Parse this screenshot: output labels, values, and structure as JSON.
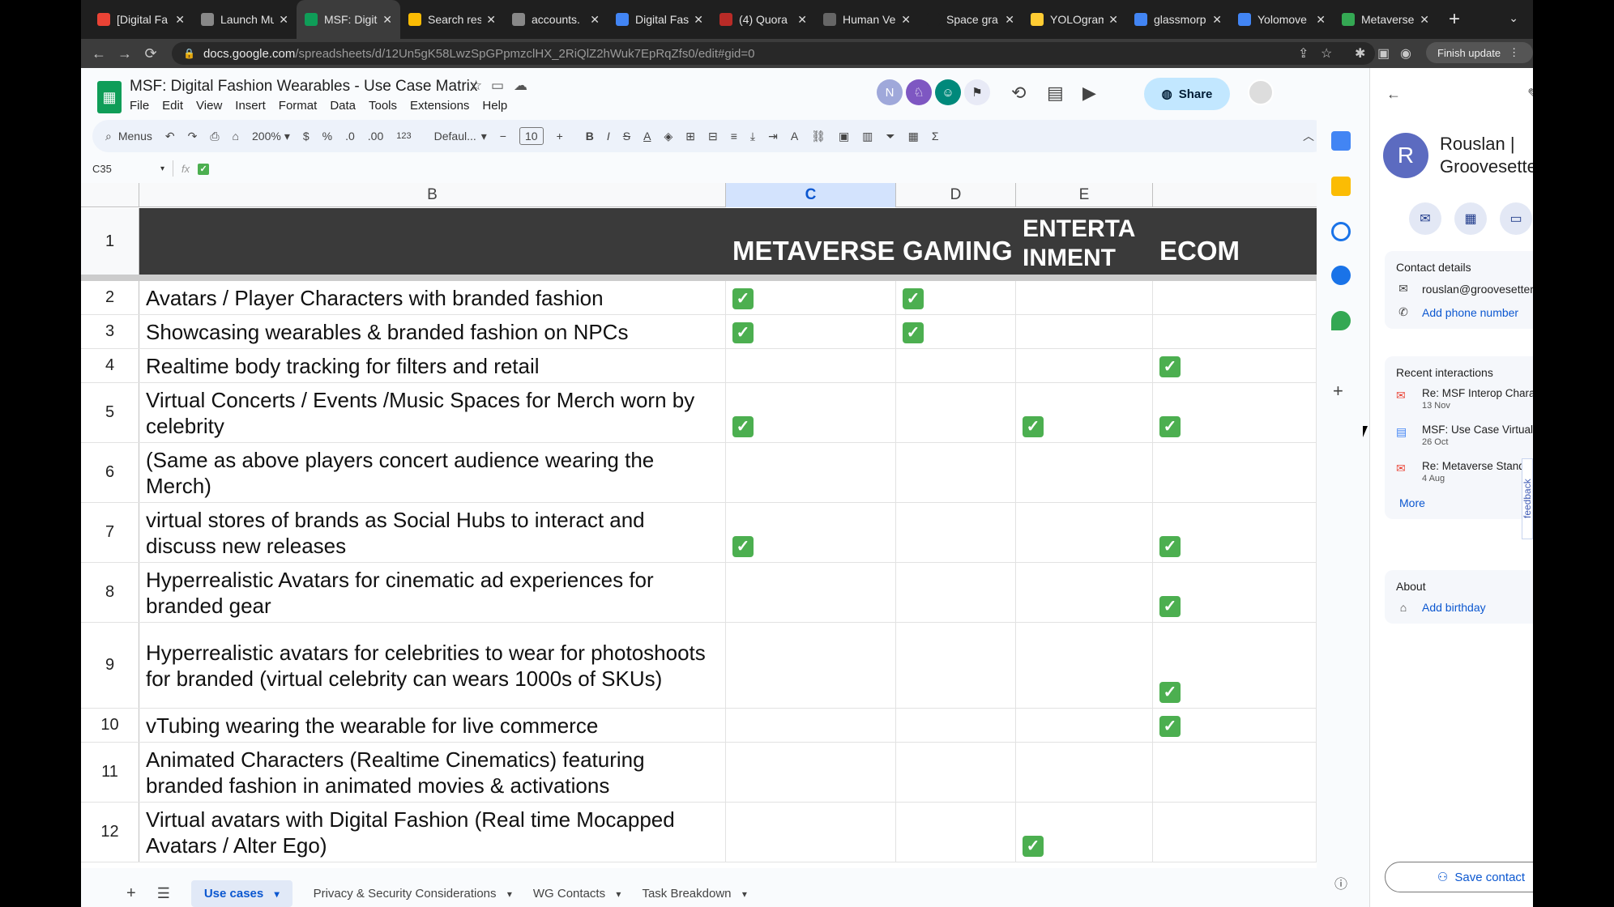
{
  "browser": {
    "tabs": [
      {
        "title": "[Digital Fa",
        "icon": "gmail-icon",
        "color": "#ea4335"
      },
      {
        "title": "Launch Mu",
        "icon": "globe-icon",
        "color": "#888888"
      },
      {
        "title": "MSF: Digit",
        "icon": "sheets-icon",
        "color": "#0f9d58"
      },
      {
        "title": "Search res",
        "icon": "drive-icon",
        "color": "#fbbc04"
      },
      {
        "title": "accounts.",
        "icon": "globe-icon",
        "color": "#888888"
      },
      {
        "title": "Digital Fas",
        "icon": "docs-icon",
        "color": "#4285f4"
      },
      {
        "title": "(4) Quora",
        "icon": "quora-icon",
        "color": "#b92b27"
      },
      {
        "title": "Human Ve",
        "icon": "doc-icon",
        "color": "#666666"
      },
      {
        "title": "Space gra",
        "icon": "blank-icon",
        "color": "#1f1f1f"
      },
      {
        "title": "YOLOgram",
        "icon": "python-icon",
        "color": "#ffcc33"
      },
      {
        "title": "glassmorp",
        "icon": "google-icon",
        "color": "#4285f4"
      },
      {
        "title": "Yolomove",
        "icon": "docs-icon",
        "color": "#4285f4"
      },
      {
        "title": "Metaverse",
        "icon": "gmail-icon",
        "color": "#34a853"
      }
    ],
    "active_tab_index": 2,
    "url_domain": "docs.google.com",
    "url_path": "/spreadsheets/d/12Un5gK58LwzSpGPpmzclHX_2RiQlZ2hWuk7EpRqZfs0/edit#gid=0",
    "finish_update": "Finish update"
  },
  "sheet": {
    "title": "MSF: Digital Fashion Wearables  - Use Case Matrix",
    "menus": [
      "File",
      "Edit",
      "View",
      "Insert",
      "Format",
      "Data",
      "Tools",
      "Extensions",
      "Help"
    ],
    "share_label": "Share",
    "collab_initial": "N",
    "toolbar": {
      "menus": "Menus",
      "zoom": "200%",
      "currency": "$",
      "percent": "%",
      "dec_less": ".0",
      "dec_more": ".00",
      "num_format": "123",
      "font": "Defaul...",
      "font_size": "10"
    },
    "name_box": "C35",
    "fx_label": "fx",
    "columns": [
      "B",
      "C",
      "D",
      "E"
    ],
    "selected_column": "C",
    "header_row": {
      "num": "1",
      "cells": [
        "METAVERSE",
        "GAMING",
        "ENTERTA INMENT",
        "ECOM"
      ]
    },
    "rows": [
      {
        "num": "2",
        "text": "Avatars / Player Characters with branded fashion",
        "checks": [
          true,
          true,
          false,
          false
        ]
      },
      {
        "num": "3",
        "text": "Showcasing wearables & branded fashion on NPCs",
        "checks": [
          true,
          true,
          false,
          false
        ]
      },
      {
        "num": "4",
        "text": "Realtime body tracking for filters and retail",
        "checks": [
          false,
          false,
          false,
          true
        ]
      },
      {
        "num": "5",
        "text": "Virtual Concerts / Events /Music Spaces for Merch worn by celebrity",
        "checks": [
          true,
          false,
          true,
          true
        ]
      },
      {
        "num": "6",
        "text": "(Same as above players concert audience wearing the Merch)",
        "checks": [
          false,
          false,
          false,
          false
        ]
      },
      {
        "num": "7",
        "text": "virtual stores of brands as Social Hubs to interact and discuss new releases",
        "checks": [
          true,
          false,
          false,
          true
        ]
      },
      {
        "num": "8",
        "text": "Hyperrealistic Avatars for cinematic ad experiences for branded gear",
        "checks": [
          false,
          false,
          false,
          true
        ]
      },
      {
        "num": "9",
        "text": "Hyperrealistic avatars for celebrities to wear for photoshoots for branded (virtual celebrity can wears 1000s of SKUs)",
        "checks": [
          false,
          false,
          false,
          true
        ]
      },
      {
        "num": "10",
        "text": "vTubing wearing the wearable for live commerce",
        "checks": [
          false,
          false,
          false,
          true
        ]
      },
      {
        "num": "11",
        "text": "Animated Characters (Realtime Cinematics) featuring branded fashion in animated movies & activations",
        "checks": [
          false,
          false,
          false,
          false
        ]
      },
      {
        "num": "12",
        "text": "Virtual avatars with Digital Fashion (Real time Mocapped Avatars / Alter Ego)",
        "checks": [
          false,
          false,
          true,
          false
        ]
      }
    ],
    "sheet_tabs": [
      "Use cases",
      "Privacy & Security Considerations",
      "WG Contacts",
      "Task Breakdown"
    ]
  },
  "contact": {
    "initial": "R",
    "name": "Rouslan | Groovesetter",
    "details_heading": "Contact details",
    "email": "rouslan@groovesetter.net",
    "add_phone": "Add phone number",
    "recent_heading": "Recent interactions",
    "interactions": [
      {
        "title": "Re: MSF Interop Characters/A...",
        "date": "13 Nov",
        "icon": "gmail-icon"
      },
      {
        "title": "MSF: Use Case Virtual Stage ...",
        "date": "26 Oct",
        "icon": "docs-icon"
      },
      {
        "title": "Re: Metaverse Standards For...",
        "date": "4 Aug",
        "icon": "gmail-icon"
      }
    ],
    "more": "More",
    "about_heading": "About",
    "add_birthday": "Add birthday",
    "save_contact": "Save contact",
    "feedback": "feedback"
  }
}
